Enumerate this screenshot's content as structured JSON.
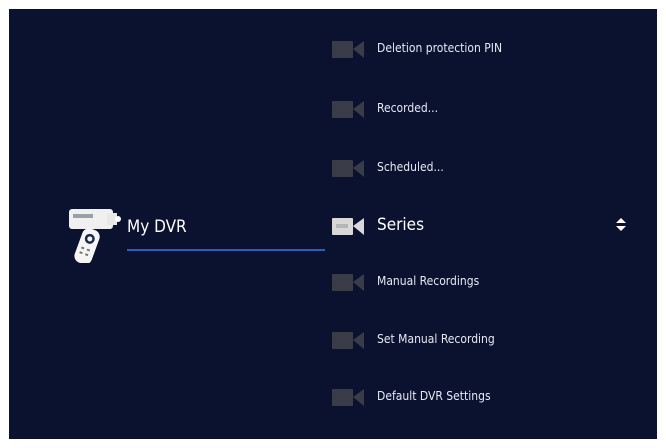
{
  "section": {
    "title": "My DVR",
    "icon": "dvr-remote-icon"
  },
  "menu": {
    "items": [
      {
        "label": "Deletion protection PIN",
        "icon": "camera-icon",
        "selected": false
      },
      {
        "label": "Recorded...",
        "icon": "camera-icon",
        "selected": false
      },
      {
        "label": "Scheduled...",
        "icon": "camera-icon",
        "selected": false
      },
      {
        "label": "Series",
        "icon": "camera-icon",
        "selected": true
      },
      {
        "label": "Manual Recordings",
        "icon": "camera-icon",
        "selected": false
      },
      {
        "label": "Set Manual Recording",
        "icon": "camera-icon",
        "selected": false
      },
      {
        "label": "Default DVR Settings",
        "icon": "camera-icon",
        "selected": false
      }
    ]
  },
  "scroll_indicator": "up-down-arrows-icon",
  "colors": {
    "background": "#0a1230",
    "accent_underline": "#2a5fb8",
    "icon_dim": "#3a3d48",
    "icon_selected": "#d8d8d8"
  }
}
